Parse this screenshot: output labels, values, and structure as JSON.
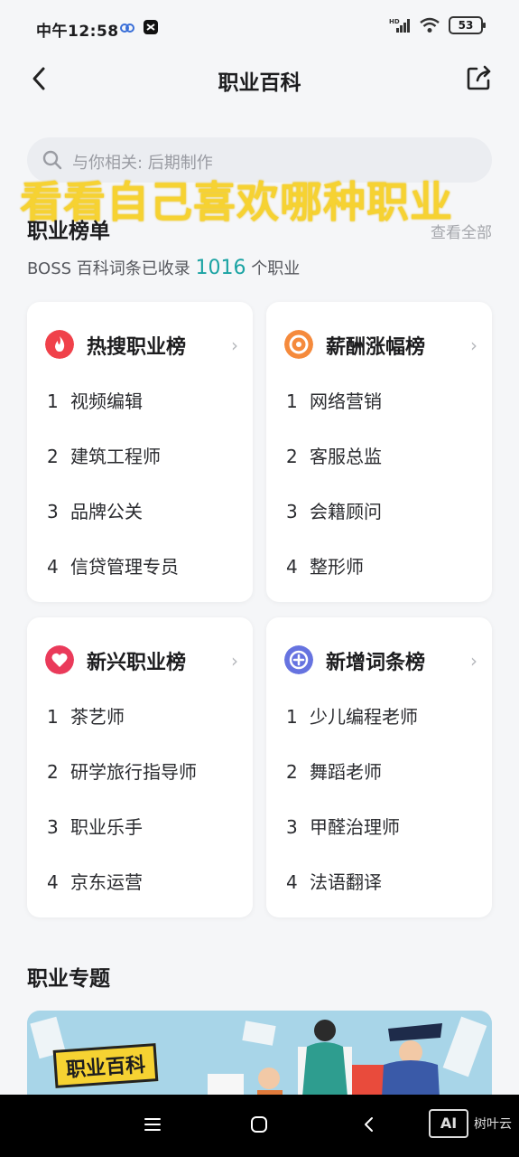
{
  "status": {
    "time": "中午12:58",
    "battery": "53",
    "network_badge": "HD"
  },
  "header": {
    "title": "职业百科"
  },
  "search": {
    "placeholder": "与你相关: 后期制作"
  },
  "overlay": {
    "caption": "看看自己喜欢哪种职业"
  },
  "rankings": {
    "title": "职业榜单",
    "view_all": "查看全部",
    "summary_prefix": "BOSS 百科词条已收录",
    "summary_count": "1016",
    "summary_suffix": "个职业",
    "cards": [
      {
        "title": "热搜职业榜",
        "icon": "flame-icon",
        "icon_color": "#f0414a",
        "items": [
          {
            "rank": "1",
            "name": "视频编辑"
          },
          {
            "rank": "2",
            "name": "建筑工程师"
          },
          {
            "rank": "3",
            "name": "品牌公关"
          },
          {
            "rank": "4",
            "name": "信贷管理专员"
          }
        ]
      },
      {
        "title": "薪酬涨幅榜",
        "icon": "coin-icon",
        "icon_color": "#f58a3c",
        "items": [
          {
            "rank": "1",
            "name": "网络营销"
          },
          {
            "rank": "2",
            "name": "客服总监"
          },
          {
            "rank": "3",
            "name": "会籍顾问"
          },
          {
            "rank": "4",
            "name": "整形师"
          }
        ]
      },
      {
        "title": "新兴职业榜",
        "icon": "heart-icon",
        "icon_color": "#ea3a5a",
        "items": [
          {
            "rank": "1",
            "name": "茶艺师"
          },
          {
            "rank": "2",
            "name": "研学旅行指导师"
          },
          {
            "rank": "3",
            "name": "职业乐手"
          },
          {
            "rank": "4",
            "name": "京东运营"
          }
        ]
      },
      {
        "title": "新增词条榜",
        "icon": "plus-icon",
        "icon_color": "#6673e0",
        "items": [
          {
            "rank": "1",
            "name": "少儿编程老师"
          },
          {
            "rank": "2",
            "name": "舞蹈老师"
          },
          {
            "rank": "3",
            "name": "甲醛治理师"
          },
          {
            "rank": "4",
            "name": "法语翻译"
          }
        ]
      }
    ]
  },
  "topics": {
    "title": "职业专题",
    "banner_tag": "职业百科"
  },
  "watermark": {
    "logo": "AI",
    "text": "树叶云"
  }
}
